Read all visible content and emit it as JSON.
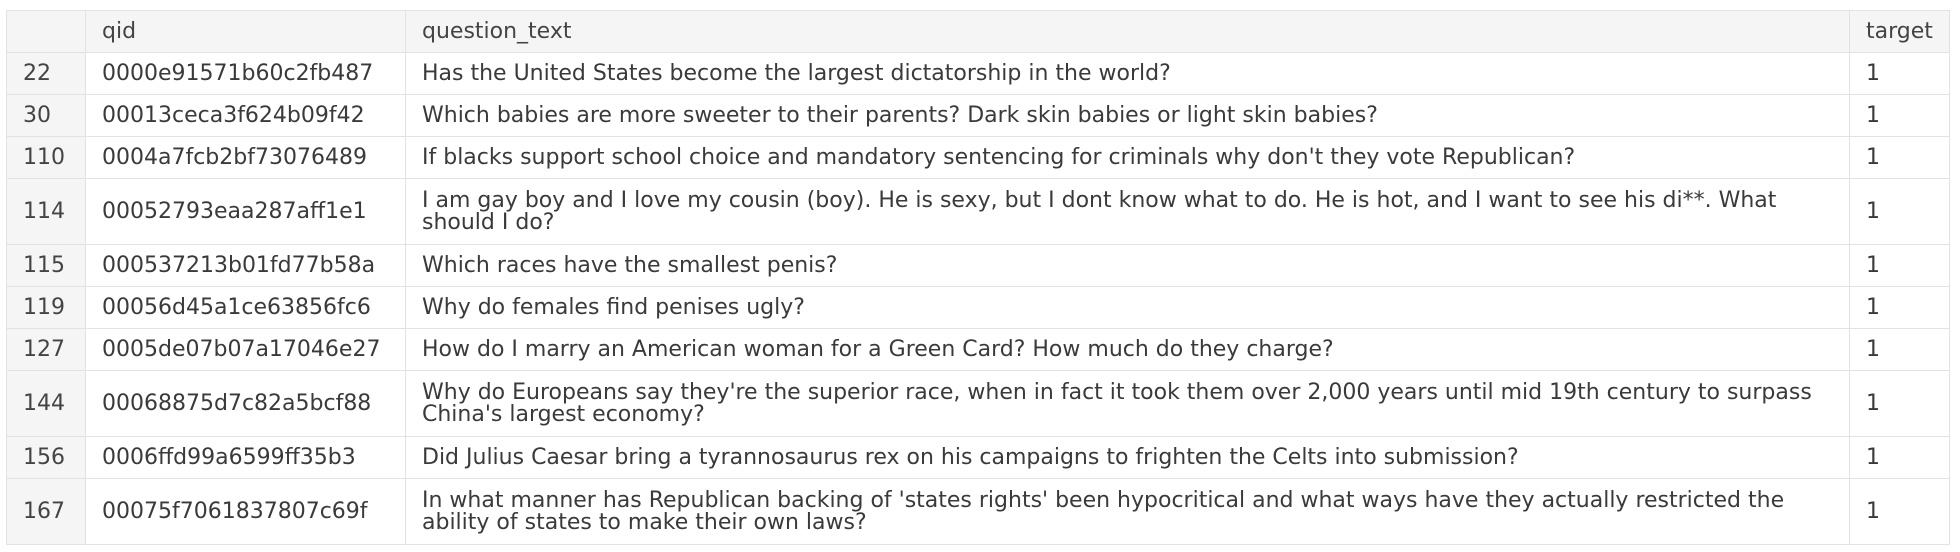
{
  "table": {
    "columns": [
      "",
      "qid",
      "question_text",
      "target"
    ],
    "rows": [
      {
        "index": "22",
        "qid": "0000e91571b60c2fb487",
        "question_text": "Has the United States become the largest dictatorship in the world?",
        "target": "1"
      },
      {
        "index": "30",
        "qid": "00013ceca3f624b09f42",
        "question_text": "Which babies are more sweeter to their parents? Dark skin babies or light skin babies?",
        "target": "1"
      },
      {
        "index": "110",
        "qid": "0004a7fcb2bf73076489",
        "question_text": "If blacks support school choice and mandatory sentencing for criminals why don't they vote Republican?",
        "target": "1"
      },
      {
        "index": "114",
        "qid": "00052793eaa287aff1e1",
        "question_text": "I am gay boy and I love my cousin (boy). He is sexy, but I dont know what to do. He is hot, and I want to see his di**. What should I do?",
        "target": "1"
      },
      {
        "index": "115",
        "qid": "000537213b01fd77b58a",
        "question_text": "Which races have the smallest penis?",
        "target": "1"
      },
      {
        "index": "119",
        "qid": "00056d45a1ce63856fc6",
        "question_text": "Why do females find penises ugly?",
        "target": "1"
      },
      {
        "index": "127",
        "qid": "0005de07b07a17046e27",
        "question_text": "How do I marry an American woman for a Green Card? How much do they charge?",
        "target": "1"
      },
      {
        "index": "144",
        "qid": "00068875d7c82a5bcf88",
        "question_text": "Why do Europeans say they're the superior race, when in fact it took them over 2,000 years until mid 19th century to surpass China's largest economy?",
        "target": "1"
      },
      {
        "index": "156",
        "qid": "0006ffd99a6599ff35b3",
        "question_text": "Did Julius Caesar bring a tyrannosaurus rex on his campaigns to frighten the Celts into submission?",
        "target": "1"
      },
      {
        "index": "167",
        "qid": "00075f7061837807c69f",
        "question_text": "In what manner has Republican backing of 'states rights' been hypocritical and what ways have they actually restricted the ability of states to make their own laws?",
        "target": "1"
      }
    ]
  }
}
